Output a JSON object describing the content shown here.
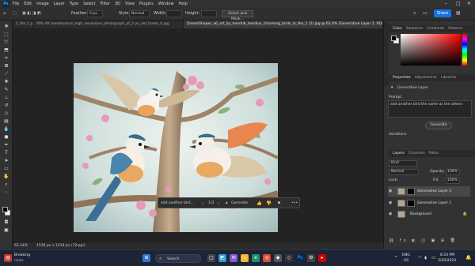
{
  "menu": {
    "logo": "Ps",
    "items": [
      "File",
      "Edit",
      "Image",
      "Layer",
      "Type",
      "Select",
      "Filter",
      "3D",
      "View",
      "Plugins",
      "Window",
      "Help"
    ]
  },
  "options": {
    "feather_label": "Feather:",
    "feather_value": "0 px",
    "style_label": "Style:",
    "style_value": "Normal",
    "width_label": "Width:",
    "height_label": "Height:",
    "select_mask_label": "Select and Mask...",
    "share_label": "Share"
  },
  "tabs": [
    "2_file_1.jpg",
    "RPG-4K masterpiece_high_resolution_photograph_of_2 yo_old_home_it.jpg",
    "DreamShaper_v6_art_by_hendrik_hondius_charming_birds_in_the_1 (2).jpg @ 62.4% (Generative Layer 2, RGB/8#) *"
  ],
  "canvas": {
    "prompt_text": "add another bird...",
    "variation_counter": "1/3",
    "generate_label": "Generate",
    "more_icon": "•••"
  },
  "status": {
    "zoom": "62.34%",
    "doc_size": "1536 px x 1210 px (72 ppi)"
  },
  "color_panel": {
    "tabs": [
      "Color",
      "Swatches",
      "Gradients",
      "Patterns"
    ],
    "gradient_hue": "#ff0000"
  },
  "properties_panel": {
    "tabs": [
      "Properties",
      "Adjustments",
      "Libraries"
    ],
    "layer_type": "Generative Layer",
    "prompt_label": "Prompt",
    "prompt_text": "add another bird the same as the others",
    "generate_label": "Generate",
    "variations_label": "Variations"
  },
  "layers_panel": {
    "tabs": [
      "Layers",
      "Channels",
      "Paths"
    ],
    "filter_label": "Kind",
    "blend_mode": "Normal",
    "opacity_label": "Opacity:",
    "opacity_value": "100%",
    "lock_label": "Lock:",
    "fill_label": "Fill:",
    "fill_value": "100%",
    "layers": [
      {
        "name": "Generative Layer 2",
        "selected": true
      },
      {
        "name": "Generative Layer 1",
        "selected": false
      },
      {
        "name": "Background",
        "selected": false
      }
    ]
  },
  "taskbar": {
    "news_title": "Breaking",
    "news_sub": "news",
    "search_label": "Search",
    "lang_top": "ENG",
    "lang_bottom": "US",
    "time": "8:24 PM",
    "date": "3/30/2023"
  }
}
